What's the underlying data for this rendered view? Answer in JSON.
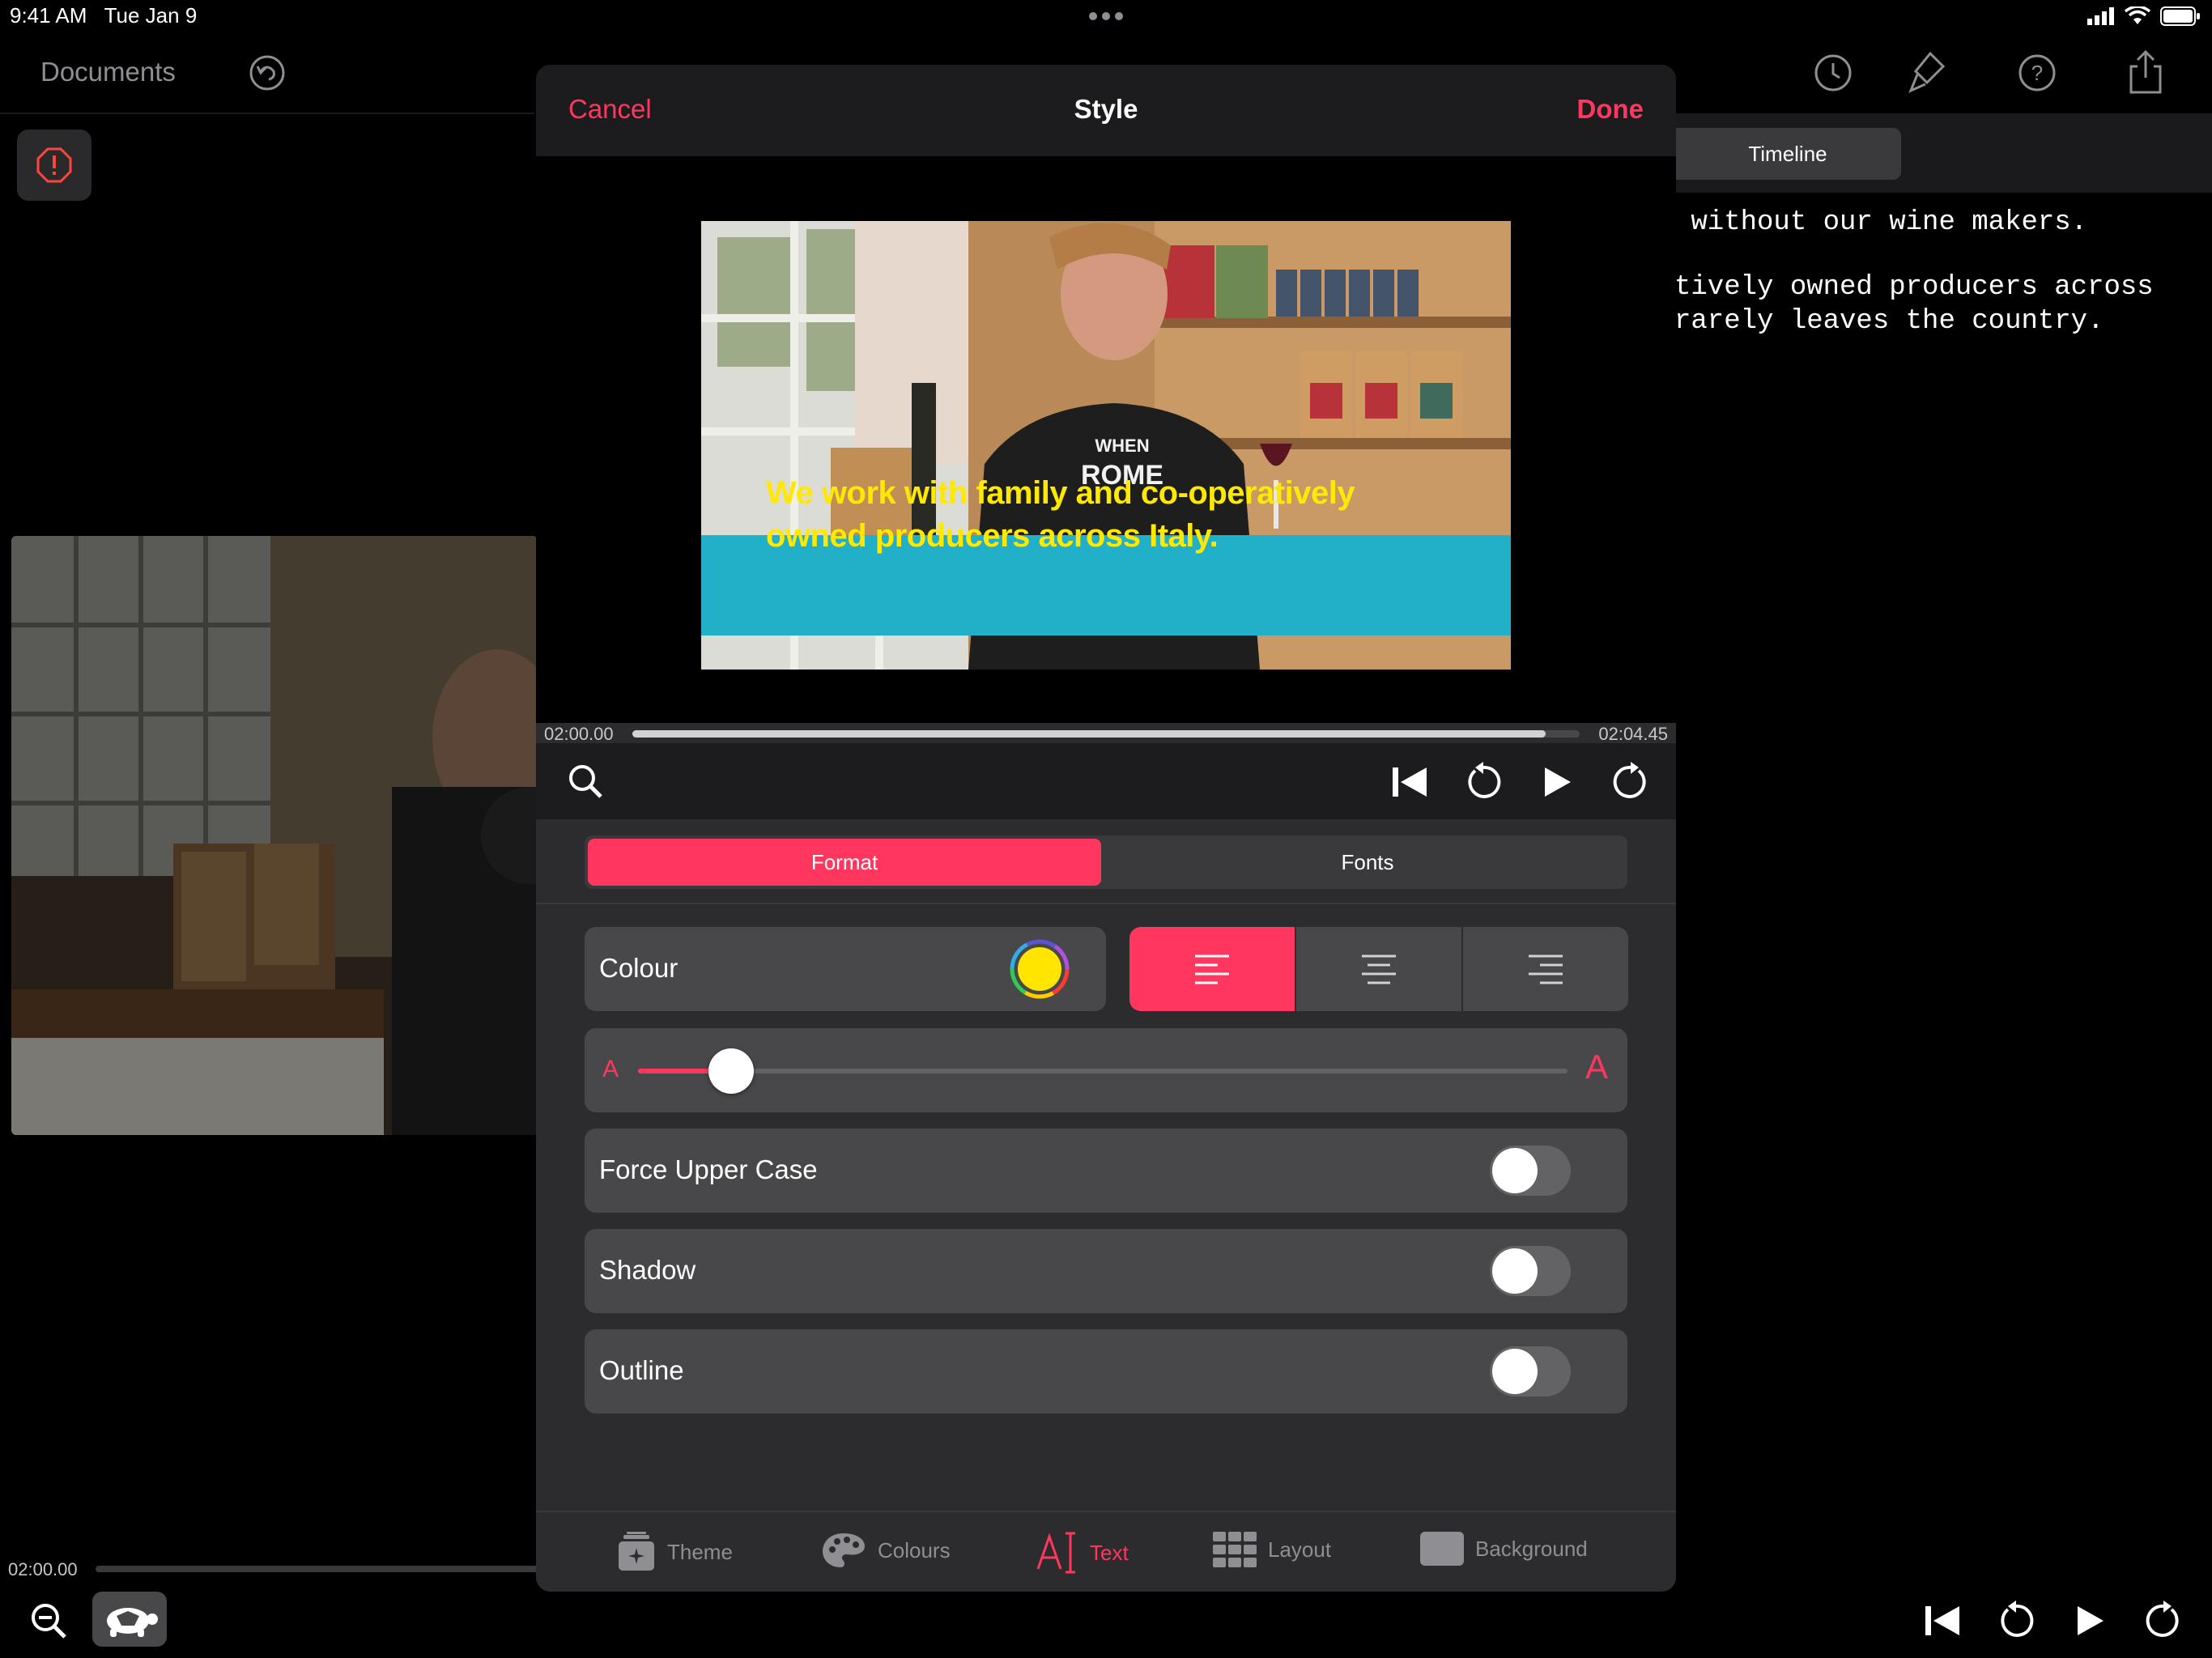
{
  "status_bar": {
    "time": "9:41 AM",
    "date": "Tue Jan 9"
  },
  "background": {
    "documents_label": "Documents",
    "timeline_label": "Timeline",
    "script_lines": [
      " without our wine makers.",
      "tively owned producers across",
      "rarely leaves the country."
    ],
    "timestamp": "02:00.00"
  },
  "modal": {
    "cancel_label": "Cancel",
    "title": "Style",
    "done_label": "Done",
    "caption_lines": [
      "We work with family and co-operatively",
      "owned producers across Italy."
    ],
    "shirt_text": {
      "line1": "WHEN",
      "line2": "ROME"
    },
    "time_start": "02:00.00",
    "time_end": "02:04.45",
    "playback_progress": 0.964,
    "segments": {
      "format_label": "Format",
      "fonts_label": "Fonts",
      "selected": "Format"
    },
    "colour": {
      "label": "Colour",
      "value": "#ffe500"
    },
    "alignment": {
      "selected": "left",
      "options": [
        "left",
        "center",
        "right"
      ]
    },
    "size_slider": {
      "min_label": "A",
      "max_label": "A",
      "value": 0.1
    },
    "toggles": [
      {
        "label": "Force Upper Case",
        "on": false
      },
      {
        "label": "Shadow",
        "on": false
      },
      {
        "label": "Outline",
        "on": false
      }
    ],
    "tabs": [
      {
        "label": "Theme",
        "icon": "theme-icon"
      },
      {
        "label": "Colours",
        "icon": "palette-icon"
      },
      {
        "label": "Text",
        "icon": "text-cursor-icon",
        "active": true
      },
      {
        "label": "Layout",
        "icon": "grid-icon"
      },
      {
        "label": "Background",
        "icon": "background-icon"
      }
    ]
  },
  "colors": {
    "accent": "#ff375f",
    "caption_bg": "#22b0c8",
    "caption_text": "#ffe900"
  }
}
